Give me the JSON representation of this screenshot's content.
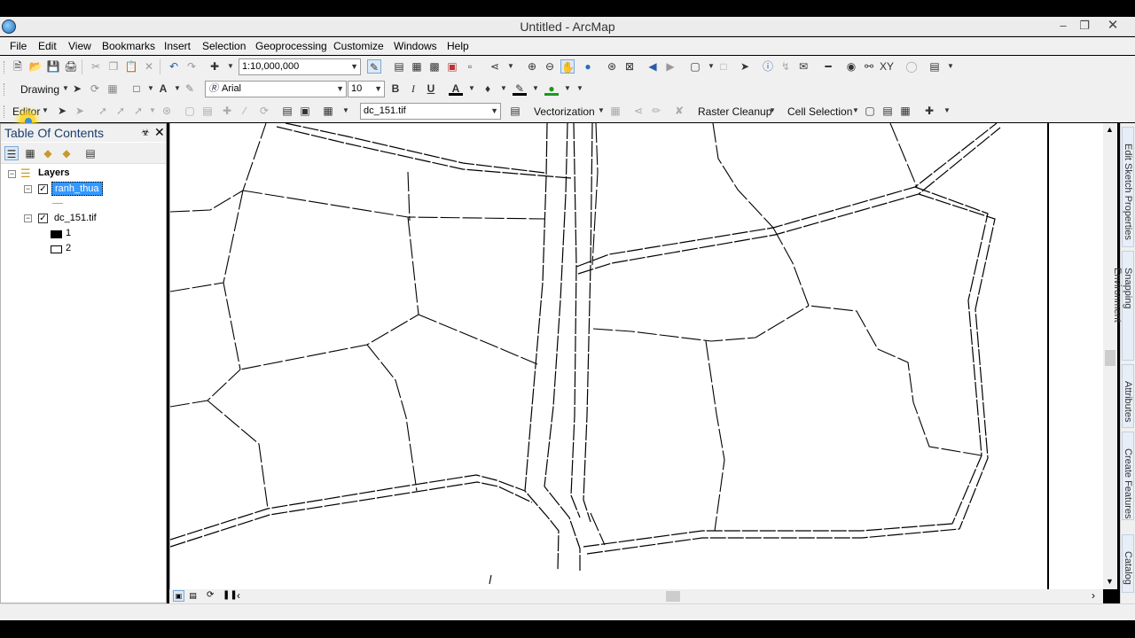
{
  "window": {
    "title": "Untitled - ArcMap"
  },
  "menu": [
    "File",
    "Edit",
    "View",
    "Bookmarks",
    "Insert",
    "Selection",
    "Geoprocessing",
    "Customize",
    "Windows",
    "Help"
  ],
  "toolbar_standard": {
    "scale_value": "1:10,000,000"
  },
  "toolbar_draw": {
    "drawing_label": "Drawing",
    "font_name": "Arial",
    "font_size": "10",
    "bold": "B",
    "italic": "I",
    "underline": "U",
    "font_color_glyph": "A"
  },
  "toolbar_editor": {
    "editor_label": "Editor",
    "layer_select": "dc_151.tif",
    "vectorization_label": "Vectorization",
    "raster_cleanup_label": "Raster Cleanup",
    "cell_selection_label": "Cell Selection"
  },
  "toc": {
    "title": "Table Of Contents",
    "group": "Layers",
    "layers": [
      {
        "name": "ranh_thua",
        "checked": true,
        "selected": true
      },
      {
        "name": "dc_151.tif",
        "checked": true,
        "selected": false,
        "classes": [
          "1",
          "2"
        ]
      }
    ]
  },
  "right_dock": [
    "Edit Sketch Properties",
    "Snapping Environment",
    "Attributes",
    "Create Features",
    "Catalog"
  ],
  "colors": {
    "selection_blue": "#3399ff",
    "line_swatch": "#c8b800",
    "toc_title": "#1b3d6d"
  }
}
